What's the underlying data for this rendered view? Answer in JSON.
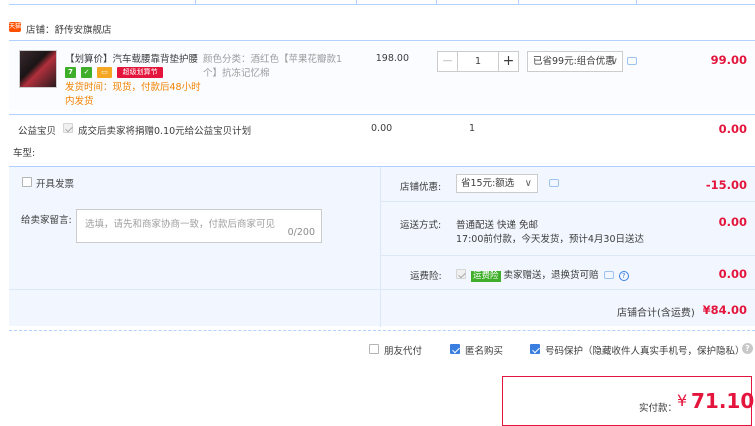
{
  "shop": {
    "icon": "tmall-shop-icon",
    "icon_label": "天猫",
    "label": "店铺：舒传安旗舰店"
  },
  "item": {
    "title": "【划算价】汽车载腰靠背垫护腰…",
    "badges": {
      "seven_day": "7",
      "super": "超级划算节"
    },
    "ship_note": [
      "发货时间：现货，付款后48小时",
      "内发货"
    ],
    "sku": [
      "颜色分类：酒红色【苹果花瓣款1",
      "个】抗冻记忆棉"
    ],
    "price": "198.00",
    "quantity": "1",
    "qty_minus": "−",
    "qty_plus": "+",
    "promo_select": "已省99元:组合优惠",
    "subtotal": "99.00"
  },
  "charity": {
    "label": "公益宝贝",
    "text": "成交后卖家将捐赠0.10元给公益宝贝计划",
    "price": "0.00",
    "qty": "1",
    "subtotal": "0.00"
  },
  "car_model": "车型:",
  "invoice": {
    "label": "开具发票"
  },
  "message": {
    "label": "给卖家留言:",
    "placeholder": "选填，请先和商家协商一致，付款后商家可见",
    "counter": "0/200"
  },
  "shop_discount": {
    "label": "店铺优惠:",
    "select": "省15元:额选",
    "amount": "-15.00"
  },
  "delivery": {
    "label": "运送方式:",
    "line1": "普通配送 快递 免邮",
    "line2": "17:00前付款，今天发货，预计4月30日送达",
    "amount": "0.00"
  },
  "shipping_insurance": {
    "label": "运费险:",
    "tag": "运费险",
    "text": "卖家赠送，退换货可赔",
    "amount": "0.00"
  },
  "shop_total": {
    "label": "店铺合计(含运费)",
    "value": "¥84.00"
  },
  "footer_options": {
    "friend_pay": "朋友代付",
    "anonymous": "匿名购买",
    "number_protect": "号码保护（隐藏收件人真实手机号，保护隐私）"
  },
  "payment": {
    "label": "实付款：",
    "currency": "¥",
    "amount": "71.10"
  },
  "colors": {
    "accent_red": "#e4153d",
    "link_blue": "#3a7fe0",
    "border_blue": "#b2d1ff",
    "panel_bg": "#f2f7ff"
  }
}
